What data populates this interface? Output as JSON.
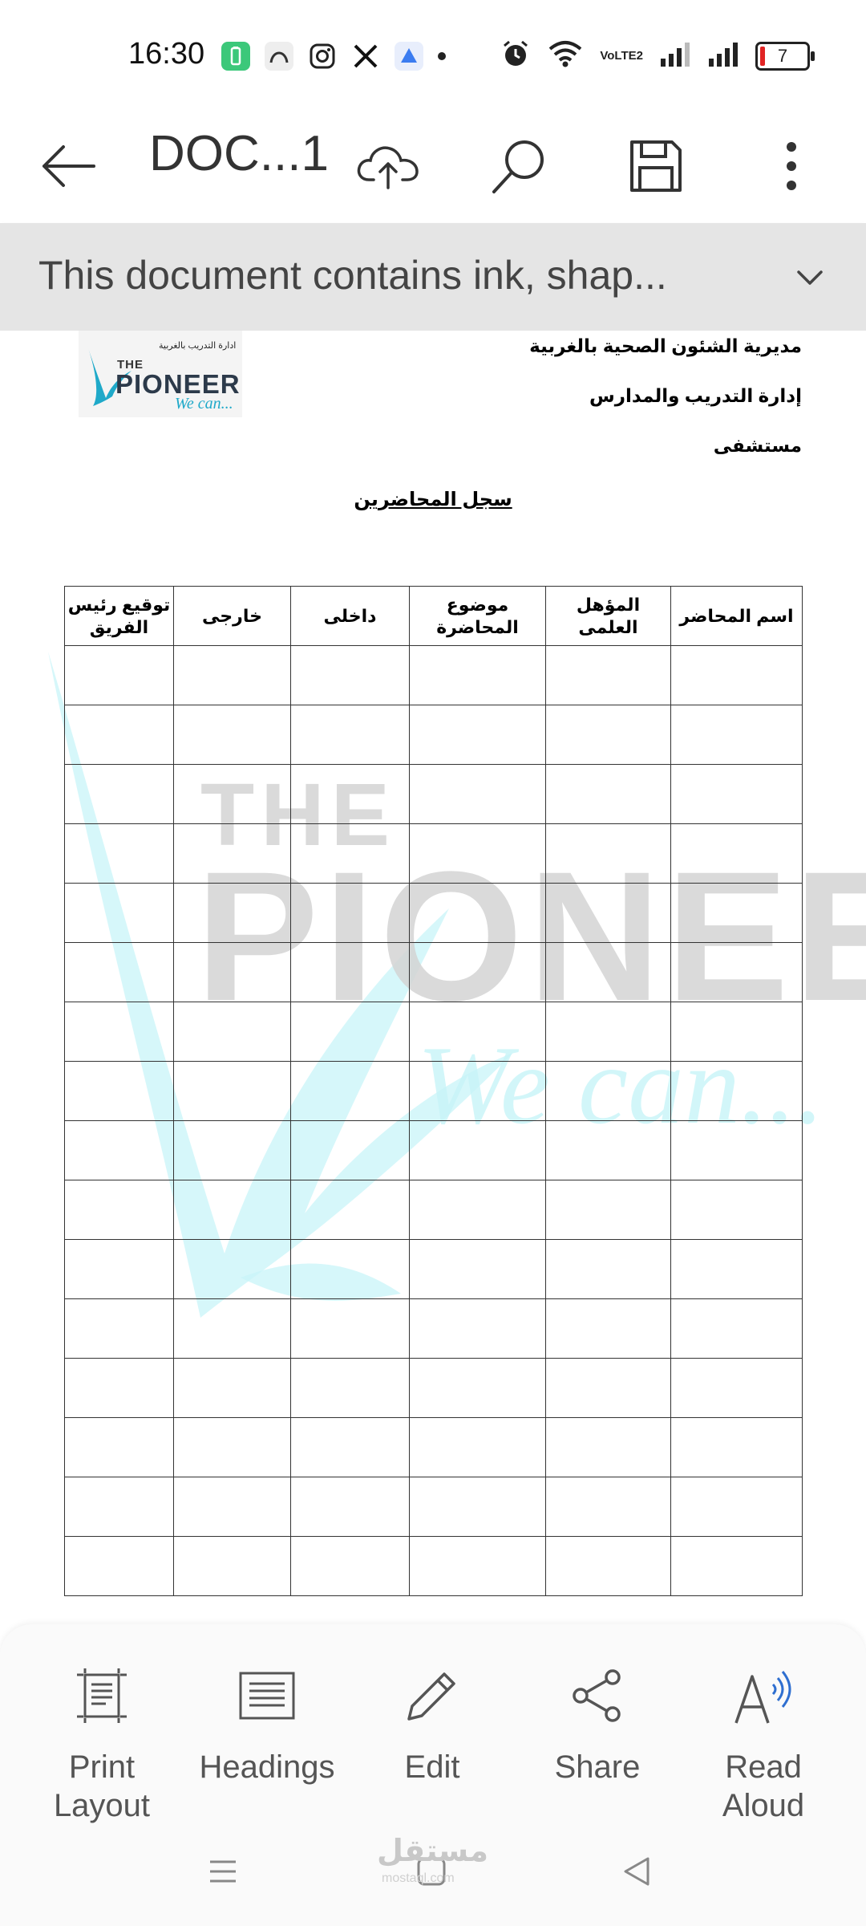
{
  "status_bar": {
    "time": "16:30",
    "battery_level": "7",
    "network_label": "VoLTE2",
    "icons": [
      "battery-saver-icon",
      "app-icon",
      "instagram-icon",
      "x-icon",
      "app-icon-2",
      "dot-icon",
      "alarm-icon",
      "wifi-icon",
      "volte-icon",
      "signal-icon",
      "signal-icon-2",
      "battery-icon"
    ]
  },
  "toolbar": {
    "title": "DOC...1",
    "buttons": [
      "back-arrow-icon",
      "cloud-upload-icon",
      "search-icon",
      "save-icon",
      "more-vertical-icon"
    ]
  },
  "banner": {
    "text": "This document contains ink, shap..."
  },
  "document": {
    "logo": {
      "tagline": "ادارة التدريب بالغربية",
      "the": "THE",
      "name": "PIONEER",
      "slogan": "We can..."
    },
    "header_lines": [
      "مديرية الشئون الصحية بالغربية",
      "إدارة التدريب والمدارس",
      "مستشفى"
    ],
    "heading": "سجل المحاضرين",
    "table": {
      "columns": [
        "اسم المحاضر",
        "المؤهل العلمى",
        "موضوع المحاضرة",
        "داخلى",
        "خارجى",
        "توقيع رئيس الفريق"
      ],
      "empty_rows": 16
    },
    "watermark": {
      "the": "THE",
      "name": "PIONEER",
      "slogan": "We can..."
    }
  },
  "bottom_actions": [
    {
      "label": "Print Layout",
      "icon": "print-layout-icon"
    },
    {
      "label": "Headings",
      "icon": "headings-icon"
    },
    {
      "label": "Edit",
      "icon": "pencil-icon"
    },
    {
      "label": "Share",
      "icon": "share-icon"
    },
    {
      "label": "Read Aloud",
      "icon": "read-aloud-icon"
    }
  ],
  "nav_bar": {
    "buttons": [
      "recents-icon",
      "home-icon",
      "back-icon"
    ],
    "watermark": "مستقل",
    "watermark_sub": "mostaql.com"
  }
}
